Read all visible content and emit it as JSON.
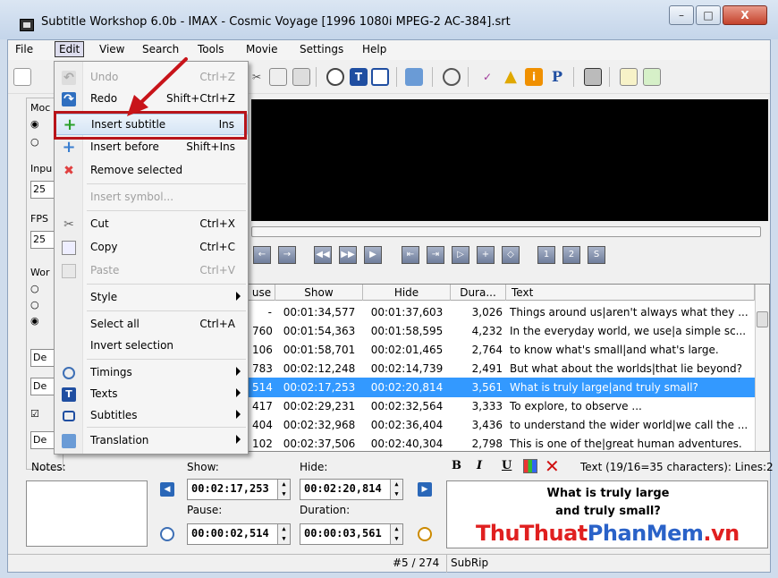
{
  "window": {
    "title": "Subtitle Workshop 6.0b - IMAX - Cosmic Voyage [1996 1080i MPEG-2 AC-384].srt",
    "minimize": "–",
    "maximize": "□",
    "close": "X"
  },
  "menubar": {
    "file": "File",
    "edit": "Edit",
    "view": "View",
    "search": "Search",
    "tools": "Tools",
    "movie": "Movie",
    "settings": "Settings",
    "help": "Help"
  },
  "toolbar": {
    "t_label": "T",
    "p_label": "P"
  },
  "leftpanel": {
    "mode_label": "Moc",
    "input_label": "Inpu",
    "input_value": "25",
    "fps_label": "FPS",
    "fps_value": "25",
    "work_label": "Wor",
    "de1": "De",
    "de2": "De",
    "de3": "De"
  },
  "edit_menu": {
    "items": [
      {
        "label": "Undo",
        "shortcut": "Ctrl+Z"
      },
      {
        "label": "Redo",
        "shortcut": "Shift+Ctrl+Z"
      },
      {
        "label": "Insert subtitle",
        "shortcut": "Ins"
      },
      {
        "label": "Insert before",
        "shortcut": "Shift+Ins"
      },
      {
        "label": "Remove selected",
        "shortcut": ""
      },
      {
        "label": "Insert symbol...",
        "shortcut": ""
      },
      {
        "label": "Cut",
        "shortcut": "Ctrl+X"
      },
      {
        "label": "Copy",
        "shortcut": "Ctrl+C"
      },
      {
        "label": "Paste",
        "shortcut": "Ctrl+V"
      },
      {
        "label": "Style",
        "shortcut": ""
      },
      {
        "label": "Select all",
        "shortcut": "Ctrl+A"
      },
      {
        "label": "Invert selection",
        "shortcut": ""
      },
      {
        "label": "Timings",
        "shortcut": ""
      },
      {
        "label": "Texts",
        "shortcut": ""
      },
      {
        "label": "Subtitles",
        "shortcut": ""
      },
      {
        "label": "Translation",
        "shortcut": ""
      }
    ]
  },
  "grid": {
    "headers": {
      "pause": "use",
      "show": "Show",
      "hide": "Hide",
      "duration": "Dura...",
      "text": "Text"
    },
    "rows": [
      {
        "pause": "-",
        "show": "00:01:34,577",
        "hide": "00:01:37,603",
        "duration": "3,026",
        "text": "Things around us|aren't always what they ..."
      },
      {
        "pause": "760",
        "show": "00:01:54,363",
        "hide": "00:01:58,595",
        "duration": "4,232",
        "text": "In the everyday world, we use|a simple sc..."
      },
      {
        "pause": "106",
        "show": "00:01:58,701",
        "hide": "00:02:01,465",
        "duration": "2,764",
        "text": "to know what's small|and what's large."
      },
      {
        "pause": "783",
        "show": "00:02:12,248",
        "hide": "00:02:14,739",
        "duration": "2,491",
        "text": "But what about the worlds|that lie beyond?"
      },
      {
        "pause": "514",
        "show": "00:02:17,253",
        "hide": "00:02:20,814",
        "duration": "3,561",
        "text": "What is truly large|and truly small?"
      },
      {
        "pause": "417",
        "show": "00:02:29,231",
        "hide": "00:02:32,564",
        "duration": "3,333",
        "text": "To explore, to observe ..."
      },
      {
        "pause": "404",
        "show": "00:02:32,968",
        "hide": "00:02:36,404",
        "duration": "3,436",
        "text": "to understand the wider world|we call the ..."
      },
      {
        "pause": "102",
        "show": "00:02:37,506",
        "hide": "00:02:40,304",
        "duration": "2,798",
        "text": "This is one of the|great human adventures."
      }
    ]
  },
  "bottom": {
    "notes_label": "Notes:",
    "show_label": "Show:",
    "show_value": "00:02:17,253",
    "hide_label": "Hide:",
    "hide_value": "00:02:20,814",
    "pause_label": "Pause:",
    "pause_value": "00:00:02,514",
    "duration_label": "Duration:",
    "duration_value": "00:00:03,561",
    "bold": "B",
    "italic": "I",
    "underline": "U",
    "text_info": "Text (19/16=35 characters): Lines:2",
    "preview_line1": "What is truly large",
    "preview_line2": "and truly small?"
  },
  "status": {
    "position": "#5 / 274",
    "format": "SubRip"
  },
  "watermark": {
    "part1": "ThuThuat",
    "part2": "PhanMem",
    "part3": ".vn"
  }
}
